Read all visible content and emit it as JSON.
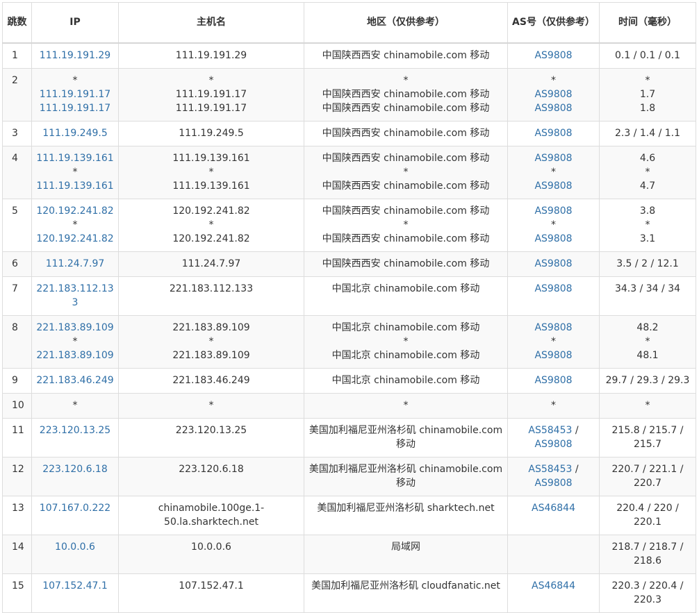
{
  "headers": {
    "hop": "跳数",
    "ip": "IP",
    "hostname": "主机名",
    "region": "地区（仅供参考）",
    "as": "AS号（仅供参考）",
    "time": "时间（毫秒）"
  },
  "colors": {
    "link": "#2f6fa7",
    "border": "#dddddd",
    "stripe": "#f9f9f9"
  },
  "rows": [
    {
      "hop": "1",
      "ip": [
        "111.19.191.29"
      ],
      "host": [
        "111.19.191.29"
      ],
      "region": [
        "中国陕西西安 chinamobile.com 移动"
      ],
      "as": [
        "AS9808"
      ],
      "time": [
        "0.1 / 0.1 / 0.1"
      ]
    },
    {
      "hop": "2",
      "ip": [
        "*",
        "111.19.191.17",
        "111.19.191.17"
      ],
      "host": [
        "*",
        "111.19.191.17",
        "111.19.191.17"
      ],
      "region": [
        "*",
        "中国陕西西安 chinamobile.com 移动",
        "中国陕西西安 chinamobile.com 移动"
      ],
      "as": [
        "*",
        "AS9808",
        "AS9808"
      ],
      "time": [
        "*",
        "1.7",
        "1.8"
      ]
    },
    {
      "hop": "3",
      "ip": [
        "111.19.249.5"
      ],
      "host": [
        "111.19.249.5"
      ],
      "region": [
        "中国陕西西安 chinamobile.com 移动"
      ],
      "as": [
        "AS9808"
      ],
      "time": [
        "2.3 / 1.4 / 1.1"
      ]
    },
    {
      "hop": "4",
      "ip": [
        "111.19.139.161",
        "*",
        "111.19.139.161"
      ],
      "host": [
        "111.19.139.161",
        "*",
        "111.19.139.161"
      ],
      "region": [
        "中国陕西西安 chinamobile.com 移动",
        "*",
        "中国陕西西安 chinamobile.com 移动"
      ],
      "as": [
        "AS9808",
        "*",
        "AS9808"
      ],
      "time": [
        "4.6",
        "*",
        "4.7"
      ]
    },
    {
      "hop": "5",
      "ip": [
        "120.192.241.82",
        "*",
        "120.192.241.82"
      ],
      "host": [
        "120.192.241.82",
        "*",
        "120.192.241.82"
      ],
      "region": [
        "中国陕西西安 chinamobile.com 移动",
        "*",
        "中国陕西西安 chinamobile.com 移动"
      ],
      "as": [
        "AS9808",
        "*",
        "AS9808"
      ],
      "time": [
        "3.8",
        "*",
        "3.1"
      ]
    },
    {
      "hop": "6",
      "ip": [
        "111.24.7.97"
      ],
      "host": [
        "111.24.7.97"
      ],
      "region": [
        "中国陕西西安 chinamobile.com 移动"
      ],
      "as": [
        "AS9808"
      ],
      "time": [
        "3.5 / 2 / 12.1"
      ]
    },
    {
      "hop": "7",
      "ip": [
        "221.183.112.133"
      ],
      "host": [
        "221.183.112.133"
      ],
      "region": [
        "中国北京 chinamobile.com 移动"
      ],
      "as": [
        "AS9808"
      ],
      "time": [
        "34.3 / 34 / 34"
      ]
    },
    {
      "hop": "8",
      "ip": [
        "221.183.89.109",
        "*",
        "221.183.89.109"
      ],
      "host": [
        "221.183.89.109",
        "*",
        "221.183.89.109"
      ],
      "region": [
        "中国北京 chinamobile.com 移动",
        "*",
        "中国北京 chinamobile.com 移动"
      ],
      "as": [
        "AS9808",
        "*",
        "AS9808"
      ],
      "time": [
        "48.2",
        "*",
        "48.1"
      ]
    },
    {
      "hop": "9",
      "ip": [
        "221.183.46.249"
      ],
      "host": [
        "221.183.46.249"
      ],
      "region": [
        "中国北京 chinamobile.com 移动"
      ],
      "as": [
        "AS9808"
      ],
      "time": [
        "29.7 / 29.3 / 29.3"
      ]
    },
    {
      "hop": "10",
      "ip": [
        "*"
      ],
      "host": [
        "*"
      ],
      "region": [
        "*"
      ],
      "as": [
        "*"
      ],
      "time": [
        "*"
      ]
    },
    {
      "hop": "11",
      "ip": [
        "223.120.13.25"
      ],
      "host": [
        "223.120.13.25"
      ],
      "region": [
        "美国加利福尼亚州洛杉矶 chinamobile.com 移动"
      ],
      "as": [
        "AS58453",
        "AS9808"
      ],
      "as_sep": " / ",
      "time": [
        "215.8 / 215.7 / 215.7"
      ]
    },
    {
      "hop": "12",
      "ip": [
        "223.120.6.18"
      ],
      "host": [
        "223.120.6.18"
      ],
      "region": [
        "美国加利福尼亚州洛杉矶 chinamobile.com 移动"
      ],
      "as": [
        "AS58453",
        "AS9808"
      ],
      "as_sep": " / ",
      "time": [
        "220.7 / 221.1 / 220.7"
      ]
    },
    {
      "hop": "13",
      "ip": [
        "107.167.0.222"
      ],
      "host": [
        "chinamobile.100ge.1-50.la.sharktech.net"
      ],
      "region": [
        "美国加利福尼亚州洛杉矶 sharktech.net"
      ],
      "as": [
        "AS46844"
      ],
      "time": [
        "220.4 / 220 / 220.1"
      ]
    },
    {
      "hop": "14",
      "ip": [
        "10.0.0.6"
      ],
      "host": [
        "10.0.0.6"
      ],
      "region": [
        "局域网"
      ],
      "as": [],
      "time": [
        "218.7 / 218.7 / 218.6"
      ]
    },
    {
      "hop": "15",
      "ip": [
        "107.152.47.1"
      ],
      "host": [
        "107.152.47.1"
      ],
      "region": [
        "美国加利福尼亚州洛杉矶 cloudfanatic.net"
      ],
      "as": [
        "AS46844"
      ],
      "time": [
        "220.3 / 220.4 / 220.3"
      ]
    }
  ]
}
